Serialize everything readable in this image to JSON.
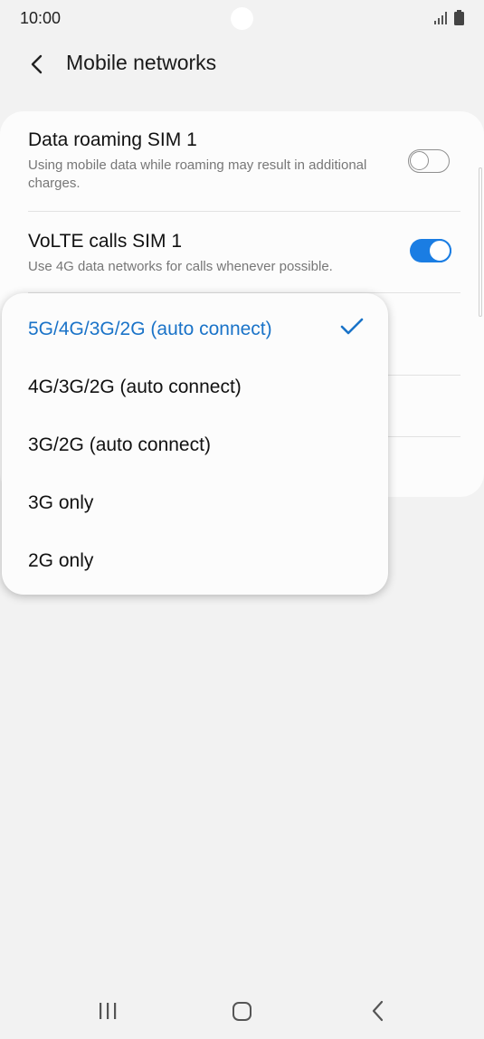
{
  "status_bar": {
    "time": "10:00"
  },
  "header": {
    "title": "Mobile networks"
  },
  "settings": [
    {
      "title": "Data roaming SIM 1",
      "subtitle": "Using mobile data while roaming may result in additional charges.",
      "toggle": "off"
    },
    {
      "title": "VoLTE calls SIM 1",
      "subtitle": "Use 4G data networks for calls whenever possible.",
      "toggle": "on"
    }
  ],
  "network_mode_menu": {
    "options": [
      "5G/4G/3G/2G (auto connect)",
      "4G/3G/2G (auto connect)",
      "3G/2G (auto connect)",
      "3G only",
      "2G only"
    ],
    "selected": "5G/4G/3G/2G (auto connect)"
  },
  "colors": {
    "accent": "#1a7de3",
    "selected_text": "#1a73c8",
    "background": "#f2f2f2"
  },
  "icons": [
    "back-arrow-icon",
    "signal-icon",
    "battery-icon",
    "check-icon",
    "recents-icon",
    "home-icon",
    "nav-back-icon"
  ]
}
